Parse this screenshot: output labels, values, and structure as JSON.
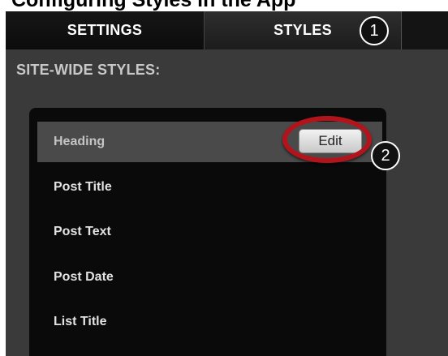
{
  "top_heading": "Configuring Styles in the App",
  "tabs": [
    {
      "label": "SETTINGS"
    },
    {
      "label": "STYLES"
    }
  ],
  "callouts": [
    "1",
    "2"
  ],
  "section_title": "SITE-WIDE STYLES:",
  "style_items": [
    {
      "label": "Heading"
    },
    {
      "label": "Post Title"
    },
    {
      "label": "Post Text"
    },
    {
      "label": "Post Date"
    },
    {
      "label": "List Title"
    }
  ],
  "edit_label": "Edit",
  "colors": {
    "highlight_ring": "#b3141c",
    "panel_bg": "#0a0a0a",
    "app_bg": "#3a3a3a"
  }
}
